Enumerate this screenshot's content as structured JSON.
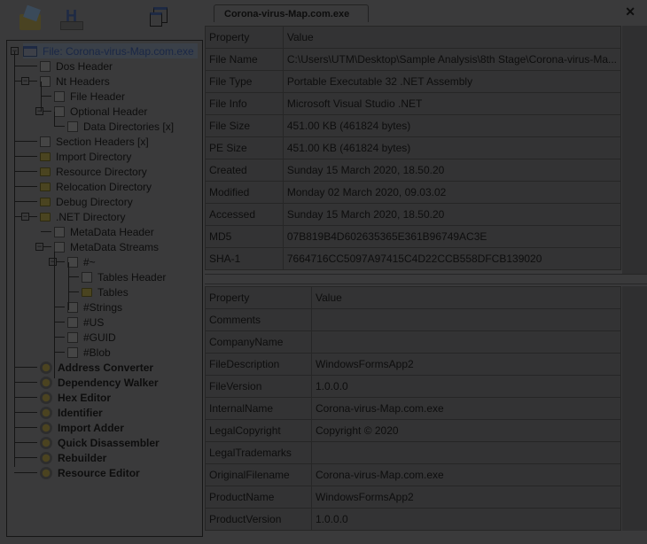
{
  "tab": {
    "title": "Corona-virus-Map.com.exe"
  },
  "tree": [
    {
      "label": "File: Corona-virus-Map.com.exe",
      "icon": "window",
      "level": 0
    },
    {
      "label": "Dos Header",
      "icon": "doc",
      "level": 1
    },
    {
      "label": "Nt Headers",
      "icon": "doc",
      "level": 1
    },
    {
      "label": "File Header",
      "icon": "doc",
      "level": 2
    },
    {
      "label": "Optional Header",
      "icon": "doc",
      "level": 2
    },
    {
      "label": "Data Directories [x]",
      "icon": "doc",
      "level": 3
    },
    {
      "label": "Section Headers [x]",
      "icon": "doc",
      "level": 1
    },
    {
      "label": "Import Directory",
      "icon": "folder",
      "level": 1
    },
    {
      "label": "Resource Directory",
      "icon": "folder",
      "level": 1
    },
    {
      "label": "Relocation Directory",
      "icon": "folder",
      "level": 1
    },
    {
      "label": "Debug Directory",
      "icon": "folder",
      "level": 1
    },
    {
      "label": ".NET Directory",
      "icon": "folder",
      "level": 1
    },
    {
      "label": "MetaData Header",
      "icon": "doc",
      "level": 2
    },
    {
      "label": "MetaData Streams",
      "icon": "doc",
      "level": 2
    },
    {
      "label": "#~",
      "icon": "doc",
      "level": 3
    },
    {
      "label": "Tables Header",
      "icon": "doc",
      "level": 4
    },
    {
      "label": "Tables",
      "icon": "folder",
      "level": 4
    },
    {
      "label": "#Strings",
      "icon": "doc",
      "level": 3
    },
    {
      "label": "#US",
      "icon": "doc",
      "level": 3
    },
    {
      "label": "#GUID",
      "icon": "doc",
      "level": 3
    },
    {
      "label": "#Blob",
      "icon": "doc",
      "level": 3
    },
    {
      "label": "Address Converter",
      "icon": "gear",
      "level": 1
    },
    {
      "label": "Dependency Walker",
      "icon": "gear",
      "level": 1
    },
    {
      "label": "Hex Editor",
      "icon": "gear",
      "level": 1
    },
    {
      "label": "Identifier",
      "icon": "gear",
      "level": 1
    },
    {
      "label": "Import Adder",
      "icon": "gear",
      "level": 1
    },
    {
      "label": "Quick Disassembler",
      "icon": "gear",
      "level": 1
    },
    {
      "label": "Rebuilder",
      "icon": "gear",
      "level": 1
    },
    {
      "label": "Resource Editor",
      "icon": "gear",
      "level": 1
    }
  ],
  "file_table": {
    "headers": [
      "Property",
      "Value"
    ],
    "rows": [
      [
        "File Name",
        "C:\\Users\\UTM\\Desktop\\Sample Analysis\\8th Stage\\Corona-virus-Ma..."
      ],
      [
        "File Type",
        "Portable Executable 32 .NET Assembly"
      ],
      [
        "File Info",
        "Microsoft Visual Studio .NET"
      ],
      [
        "File Size",
        "451.00 KB (461824 bytes)"
      ],
      [
        "PE Size",
        "451.00 KB (461824 bytes)"
      ],
      [
        "Created",
        "Sunday 15 March 2020, 18.50.20"
      ],
      [
        "Modified",
        "Monday 02 March 2020, 09.03.02"
      ],
      [
        "Accessed",
        "Sunday 15 March 2020, 18.50.20"
      ],
      [
        "MD5",
        "07B819B4D602635365E361B96749AC3E"
      ],
      [
        "SHA-1",
        "7664716CC5097A97415C4D22CCB558DFCB139020"
      ]
    ]
  },
  "version_table": {
    "headers": [
      "Property",
      "Value"
    ],
    "rows": [
      [
        "Comments",
        ""
      ],
      [
        "CompanyName",
        ""
      ],
      [
        "FileDescription",
        "WindowsFormsApp2"
      ],
      [
        "FileVersion",
        "1.0.0.0"
      ],
      [
        "InternalName",
        "Corona-virus-Map.com.exe"
      ],
      [
        "LegalCopyright",
        "Copyright ©  2020"
      ],
      [
        "LegalTrademarks",
        ""
      ],
      [
        "OriginalFilename",
        "Corona-virus-Map.com.exe"
      ],
      [
        "ProductName",
        "WindowsFormsApp2"
      ],
      [
        "ProductVersion",
        "1.0.0.0"
      ]
    ]
  }
}
